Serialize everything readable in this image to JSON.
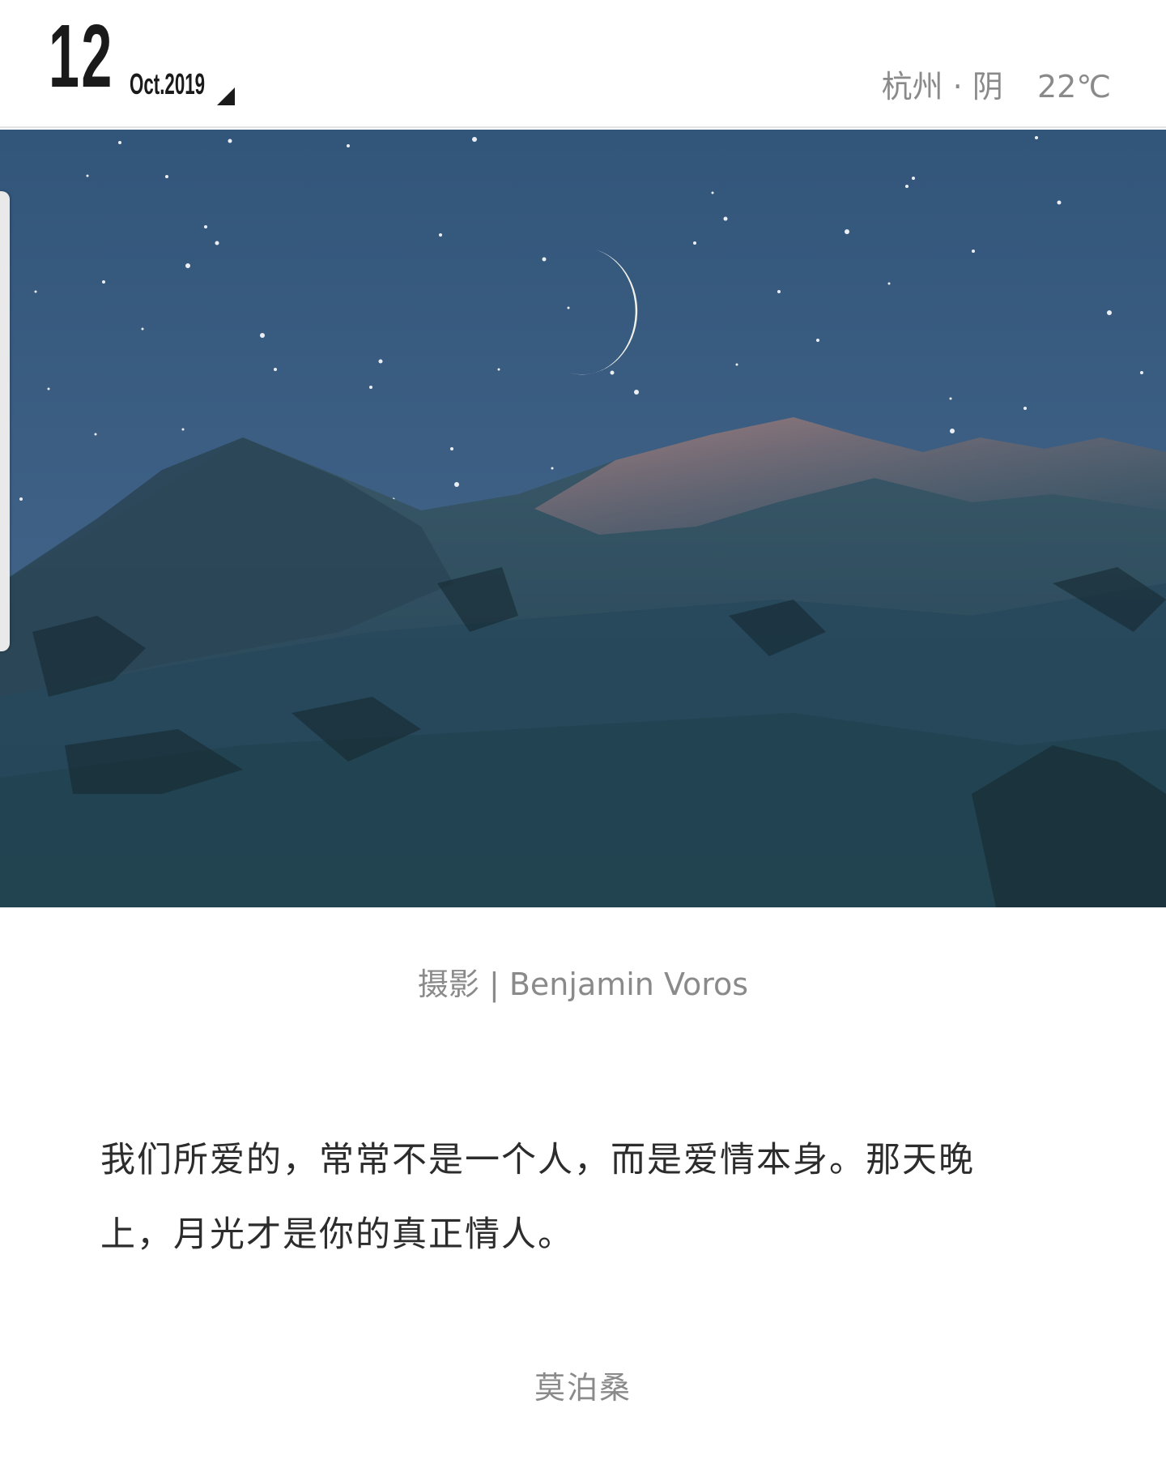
{
  "header": {
    "day": "12",
    "month_year": "Oct.2019",
    "weather": {
      "city": "杭州",
      "separator": "·",
      "condition": "阴",
      "temperature": "22℃"
    }
  },
  "photo": {
    "subject": "crescent moon over snowy mountains at dusk"
  },
  "credit": "摄影 | Benjamin Voros",
  "quote": "我们所爱的，常常不是一个人，而是爱情本身。那天晚上，月光才是你的真正情人。",
  "author": "莫泊桑",
  "colors": {
    "sky": "#3b5a7c",
    "mountain": "#2a4a5b",
    "text_primary": "#2c2c2c",
    "text_secondary": "#8a8a8a"
  }
}
